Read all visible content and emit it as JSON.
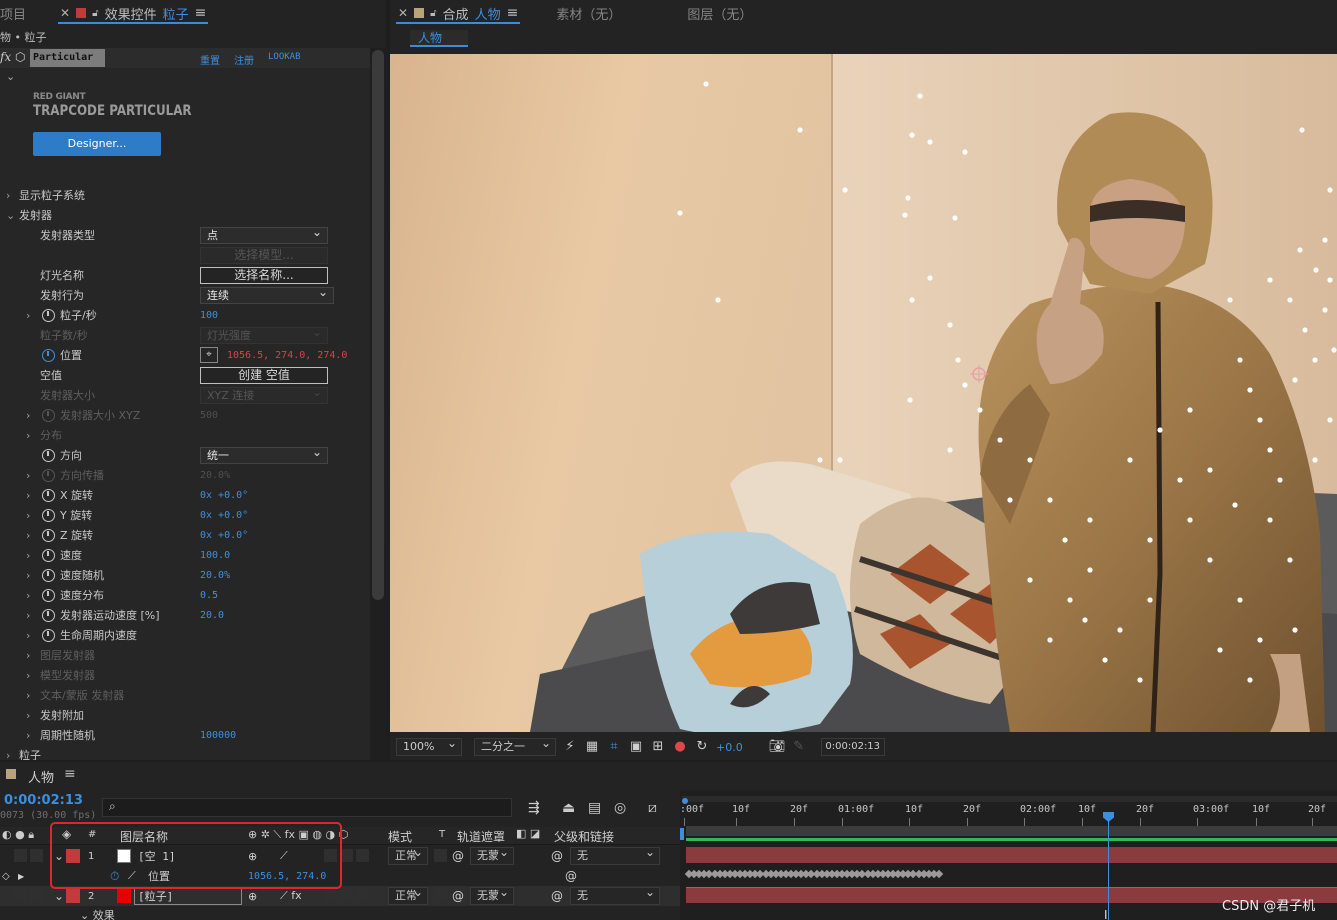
{
  "effect_panel": {
    "left_tab": "项目",
    "tab_title": "效果控件",
    "tab_layer": "粒子",
    "breadcrumb": "物 • 粒子",
    "effect_name": "Particular",
    "links": [
      "重置",
      "注册",
      "LOOKAB"
    ],
    "brand_line1": "RED GIANT",
    "brand_line2": "TRAPCODE PARTICULAR",
    "designer_button": "Designer...",
    "properties": [
      {
        "label": "显示粒子系统"
      },
      {
        "label": "发射器"
      },
      {
        "label": "发射器类型",
        "dropdown": "点"
      },
      {
        "button": "选择模型..."
      },
      {
        "label": "灯光名称",
        "button": "选择名称..."
      },
      {
        "label": "发射行为",
        "dropdown": "连续"
      },
      {
        "label": "粒子/秒",
        "value": "100"
      },
      {
        "label": "粒子数/秒",
        "dropdown": "灯光强度"
      },
      {
        "label": "位置",
        "value": "1056.5, 274.0, 274.0"
      },
      {
        "label": "空值",
        "button": "创建 空值"
      },
      {
        "label": "发射器大小",
        "dropdown": "XYZ 连接"
      },
      {
        "label": "发射器大小 XYZ",
        "value": "500"
      },
      {
        "label": "分布"
      },
      {
        "label": "方向",
        "dropdown": "统一"
      },
      {
        "label": "方向传播",
        "value": "20.0%"
      },
      {
        "label": "X 旋转",
        "value": "0x +0.0°"
      },
      {
        "label": "Y 旋转",
        "value": "0x +0.0°"
      },
      {
        "label": "Z 旋转",
        "value": "0x +0.0°"
      },
      {
        "label": "速度",
        "value": "100.0"
      },
      {
        "label": "速度随机",
        "value": "20.0%"
      },
      {
        "label": "速度分布",
        "value": "0.5"
      },
      {
        "label": "发射器运动速度 [%]",
        "value": "20.0"
      },
      {
        "label": "生命周期内速度"
      },
      {
        "label": "图层发射器"
      },
      {
        "label": "模型发射器"
      },
      {
        "label": "文本/蒙版 发射器"
      },
      {
        "label": "发射附加"
      },
      {
        "label": "周期性随机",
        "value": "100000"
      },
      {
        "label": "粒子"
      }
    ]
  },
  "comp_panel": {
    "tab_prefix": "合成",
    "tab_name": "人物",
    "footage_tab": "素材（无）",
    "layer_tab": "图层（无）",
    "comp_subtab": "人物",
    "zoom": "100%",
    "resolution": "二分之一",
    "exposure": "+0.0",
    "timecode": "0:00:02:13"
  },
  "timeline": {
    "tab": "人物",
    "current_time": "0:00:02:13",
    "frame_info": "0073 (30.00 fps)",
    "columns": {
      "num": "#",
      "layer_name": "图层名称",
      "mode": "模式",
      "t": "T",
      "track_matte": "轨道遮罩",
      "parent": "父级和链接"
    },
    "ruler": [
      ":00f",
      "10f",
      "20f",
      "01:00f",
      "10f",
      "20f",
      "02:00f",
      "10f",
      "20f",
      "03:00f",
      "10f",
      "20f"
    ],
    "layers": [
      {
        "num": "1",
        "name": "[空 1]",
        "mode": "正常",
        "matte": "无蒙",
        "parent": "无",
        "color": "#c23b3b",
        "swatch": "#ffffff"
      },
      {
        "num": "2",
        "name": "[粒子]",
        "mode": "正常",
        "matte": "无蒙",
        "parent": "无",
        "color": "#c23b3b",
        "swatch": "#e60000"
      }
    ],
    "position_prop": {
      "label": "位置",
      "value": "1056.5, 274.0"
    },
    "effects_label": "效果"
  },
  "watermark": "CSDN @君子机",
  "colors": {
    "accent": "#3d8fde",
    "highlight_box": "#e0262b",
    "layer_bar": "#8b3a3e",
    "keyframe_red": "#d64444"
  }
}
